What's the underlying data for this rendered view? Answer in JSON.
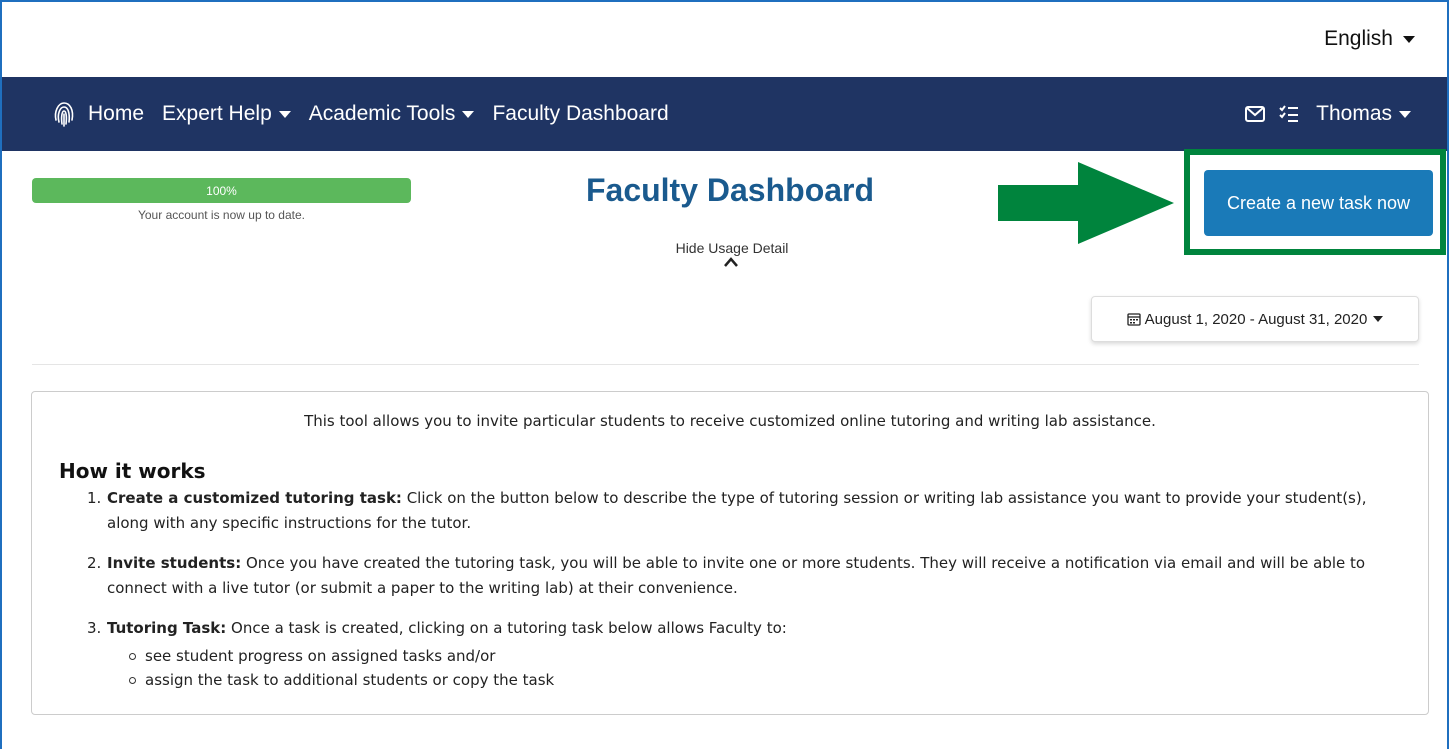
{
  "language": {
    "label": "English"
  },
  "nav": {
    "logo_icon": "fingerprint-logo-icon",
    "items": [
      {
        "label": "Home",
        "has_dropdown": false
      },
      {
        "label": "Expert Help",
        "has_dropdown": true
      },
      {
        "label": "Academic Tools",
        "has_dropdown": true
      },
      {
        "label": "Faculty Dashboard",
        "has_dropdown": false
      }
    ],
    "mail_icon": "envelope-icon",
    "tasks_icon": "checklist-icon",
    "user": "Thomas",
    "bg_color": "#1f3463"
  },
  "progress": {
    "value": 1.0,
    "label": "100%",
    "text": "Your account is now up to date.",
    "color": "#5cb85c"
  },
  "page": {
    "title": "Faculty Dashboard",
    "hide_usage": "Hide Usage Detail"
  },
  "create_button": {
    "label": "Create a new task now",
    "color": "#1a7ab8",
    "highlight_color": "#00843d"
  },
  "date_range": {
    "label": "August 1, 2020 - August 31, 2020",
    "icon": "calendar-icon"
  },
  "info": {
    "intro": "This tool allows you to invite particular students to receive customized online tutoring and writing lab assistance.",
    "how_title": "How it works",
    "steps": [
      {
        "num": "1.",
        "bold": "Create a customized tutoring task:",
        "text": " Click on the button below to describe the type of tutoring session or writing lab assistance you want to provide your student(s), along with any specific instructions for the tutor."
      },
      {
        "num": "2.",
        "bold": "Invite students:",
        "text": " Once you have created the tutoring task, you will be able to invite one or more students. They will receive a notification via email and will be able to connect with a live tutor (or submit a paper to the writing lab) at their convenience."
      },
      {
        "num": "3.",
        "bold": "Tutoring Task:",
        "text": " Once a task is created, clicking on a tutoring task below allows Faculty to:"
      }
    ],
    "subitems": [
      "see student progress on assigned tasks and/or",
      "assign the task to additional students or copy the task"
    ]
  }
}
